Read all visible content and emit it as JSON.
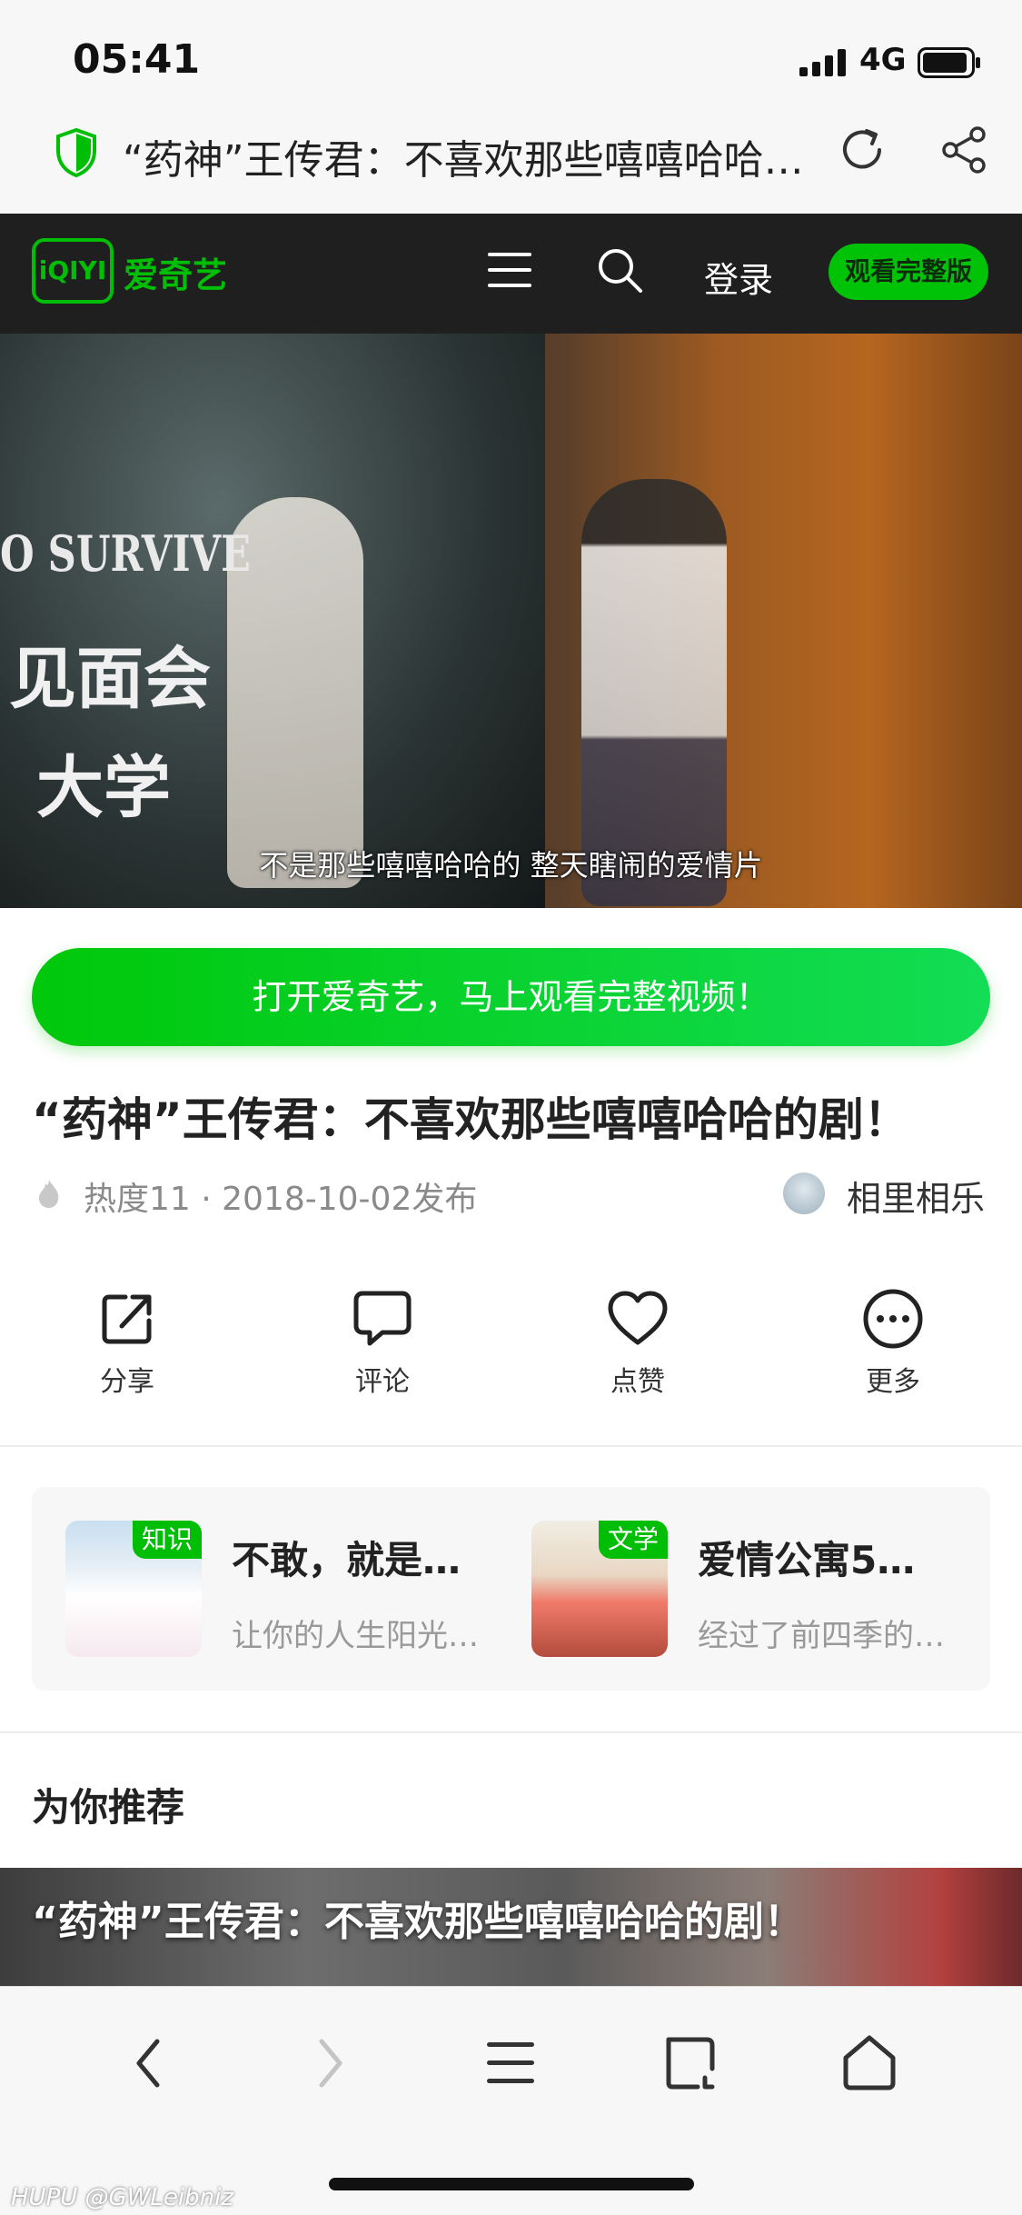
{
  "status_bar": {
    "time": "05:41",
    "network": "4G"
  },
  "address_bar": {
    "title": "“药神”王传君：不喜欢那些嘻嘻哈哈的剧！"
  },
  "header": {
    "logo_mark": "iQIYI",
    "logo_text": "爱奇艺",
    "login": "登录",
    "watch_full": "观看完整版"
  },
  "video": {
    "poster_text_en": "O SURVIVE",
    "poster_text_cn1": "见面会",
    "poster_text_cn2": "大学",
    "subtitle": "不是那些嘻嘻哈哈的 整天瞎闹的爱情片"
  },
  "cta": {
    "open_app": "打开爱奇艺，马上观看完整视频！"
  },
  "article": {
    "title": "“药神”王传君：不喜欢那些嘻嘻哈哈的剧！",
    "meta": "热度11 · 2018-10-02发布",
    "author": "相里相乐"
  },
  "actions": [
    {
      "label": "分享",
      "icon": "share-icon"
    },
    {
      "label": "评论",
      "icon": "comment-icon"
    },
    {
      "label": "点赞",
      "icon": "heart-icon"
    },
    {
      "label": "更多",
      "icon": "more-icon"
    }
  ],
  "books": [
    {
      "tag": "知识",
      "title": "不敢，就是…",
      "desc": "让你的人生阳光…"
    },
    {
      "tag": "文学",
      "title": "爱情公寓5…",
      "desc": "经过了前四季的…"
    }
  ],
  "recommend": {
    "heading": "为你推荐",
    "first_title": "“药神”王传君：不喜欢那些嘻嘻哈哈的剧！"
  },
  "watermark": "HUPU @GWLeibniz",
  "colors": {
    "brand_green": "#00be06",
    "header_bg": "#1f1f1f"
  }
}
